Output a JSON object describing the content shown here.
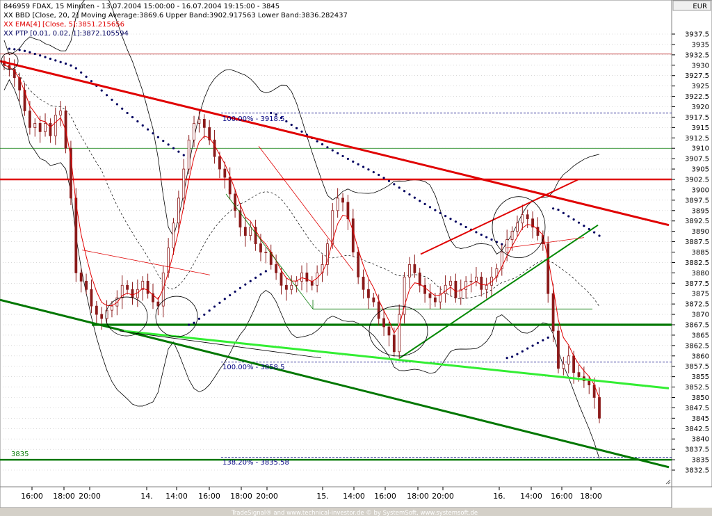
{
  "header": {
    "line1": "846959  FDAX, 15 Minuten - 13.07.2004 15:00:00 - 16.07.2004 19:15:00 - 3845",
    "line2": "XX BBD [Close, 20, 2] Moving Average:3869.6 Upper Band:3902.917563 Lower Band:3836.282437",
    "line3": "XX EMA[4] [Close, 5]:3851.215656",
    "line4": "XX PTP [0.01, 0.02, 1]:3872.105594"
  },
  "currency": "EUR",
  "footer": "TradeSignal® and www.technical-investor.de © by SystemSoft, www.systemsoft.de",
  "annotations": {
    "fib_top": "100.00% - 3918.5",
    "fib_mid": "100.00% - 3858.5",
    "fib_low": "138.20% - 3835.58",
    "level_3835": "3835"
  },
  "colors": {
    "candle_down": "#8b1a1a",
    "ema": "#e00000",
    "psar": "#000060",
    "support_dark": "#007700",
    "support_light": "#33ee33",
    "resistance": "#e00000",
    "bollinger": "#000000"
  },
  "chart_data": {
    "type": "candlestick",
    "title": "846959  FDAX, 15 Minuten - 13.07.2004 15:00:00 - 16.07.2004 19:15:00 - 3845",
    "ylabel": "EUR",
    "ylim": [
      3831,
      3941
    ],
    "x_tick_labels": [
      "16:00",
      "18:00",
      "20:00",
      "14.",
      "14:00",
      "16:00",
      "18:00",
      "20:00",
      "15.",
      "14:00",
      "16:00",
      "18:00",
      "20:00",
      "16.",
      "14:00",
      "16:00",
      "18:00"
    ],
    "y_tick_labels": [
      "3937.5",
      "3935",
      "3932.5",
      "3930",
      "3927.5",
      "3925",
      "3922.5",
      "3920",
      "3917.5",
      "3915",
      "3912.5",
      "3910",
      "3907.5",
      "3905",
      "3902.5",
      "3900",
      "3897.5",
      "3895",
      "3892.5",
      "3890",
      "3887.5",
      "3885",
      "3882.5",
      "3880",
      "3877.5",
      "3875",
      "3872.5",
      "3870",
      "3867.5",
      "3865",
      "3862.5",
      "3860",
      "3857.5",
      "3855",
      "3852.5",
      "3850",
      "3847.5",
      "3845",
      "3842.5",
      "3840",
      "3837.5",
      "3835",
      "3832.5"
    ],
    "horizontal_levels": [
      3932.7,
      3918.5,
      3910,
      3902.5,
      3871.3,
      3867.5,
      3858.5,
      3835.58,
      3835
    ],
    "close_series": [
      3930,
      3929,
      3927,
      3924,
      3919,
      3915,
      3916,
      3914,
      3916,
      3913,
      3918,
      3919,
      3910,
      3898,
      3880,
      3878,
      3876,
      3872,
      3870,
      3869,
      3871,
      3872,
      3874,
      3877,
      3876,
      3874,
      3876,
      3878,
      3875,
      3873,
      3872,
      3880,
      3886,
      3892,
      3898,
      3905,
      3912,
      3916,
      3917,
      3915,
      3912,
      3908,
      3905,
      3903,
      3899,
      3895,
      3891,
      3889,
      3891,
      3887,
      3885,
      3885,
      3882,
      3880,
      3877,
      3876,
      3877,
      3878,
      3880,
      3878,
      3877,
      3880,
      3882,
      3887,
      3895,
      3898,
      3897,
      3893,
      3885,
      3879,
      3876,
      3874,
      3873,
      3869,
      3867,
      3865,
      3861,
      3870,
      3879,
      3882,
      3880,
      3877,
      3875,
      3874,
      3873,
      3875,
      3877,
      3878,
      3874,
      3876,
      3878,
      3878,
      3879,
      3876,
      3877,
      3879,
      3881,
      3885,
      3888,
      3890,
      3892,
      3894,
      3893,
      3891,
      3889,
      3887,
      3875,
      3866,
      3857,
      3858,
      3860,
      3856,
      3855,
      3854,
      3853,
      3850,
      3845
    ]
  }
}
